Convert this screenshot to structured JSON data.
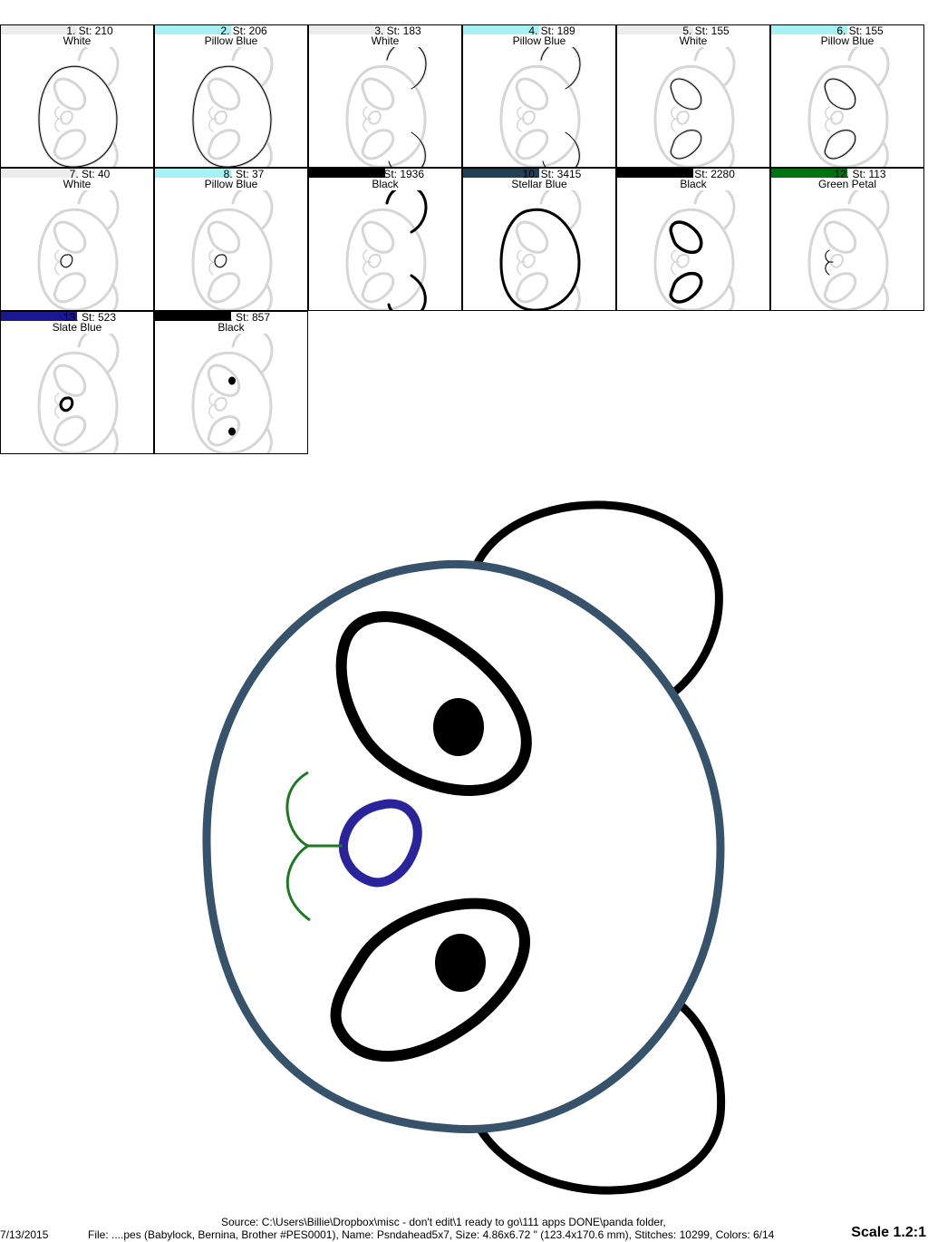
{
  "color_stops": [
    {
      "label": "1. St: 210",
      "color_name": "White",
      "bar_color": "#ececec",
      "part": "face-tack",
      "outline": "#000000"
    },
    {
      "label": "2. St: 206",
      "color_name": "Pillow Blue",
      "bar_color": "#a6f1f4",
      "part": "face-tack",
      "outline": "#000000"
    },
    {
      "label": "3. St: 183",
      "color_name": "White",
      "bar_color": "#ececec",
      "part": "ears-tack",
      "outline": "#000000"
    },
    {
      "label": "4. St: 189",
      "color_name": "Pillow Blue",
      "bar_color": "#a6f1f4",
      "part": "ears-tack",
      "outline": "#000000"
    },
    {
      "label": "5. St: 155",
      "color_name": "White",
      "bar_color": "#ececec",
      "part": "eyes-tack",
      "outline": "#000000"
    },
    {
      "label": "6. St: 155",
      "color_name": "Pillow Blue",
      "bar_color": "#a6f1f4",
      "part": "eyes-tack",
      "outline": "#000000"
    },
    {
      "label": "7. St: 40",
      "color_name": "White",
      "bar_color": "#ececec",
      "part": "nose-tack",
      "outline": "#000000"
    },
    {
      "label": "8. St: 37",
      "color_name": "Pillow Blue",
      "bar_color": "#a6f1f4",
      "part": "nose-tack",
      "outline": "#000000"
    },
    {
      "label": "9. St: 1936",
      "color_name": "Black",
      "bar_color": "#000000",
      "part": "ears-satin",
      "outline": "#000000"
    },
    {
      "label": "10. St: 3415",
      "color_name": "Stellar Blue",
      "bar_color": "#233f56",
      "part": "face-satin",
      "outline": "#000000"
    },
    {
      "label": "11. St: 2280",
      "color_name": "Black",
      "bar_color": "#000000",
      "part": "eyes-satin",
      "outline": "#000000"
    },
    {
      "label": "12. St: 113",
      "color_name": "Green Petal",
      "bar_color": "#00720f",
      "part": "mouth",
      "outline": "#000000"
    },
    {
      "label": "13. St: 523",
      "color_name": "Slate Blue",
      "bar_color": "#1b178f",
      "part": "nose-satin",
      "outline": "#000000"
    },
    {
      "label": "14. St: 857",
      "color_name": "Black",
      "bar_color": "#000000",
      "part": "pupils",
      "outline": "#000000"
    }
  ],
  "preview": {
    "ear_color": "#000000",
    "face_color": "#36536b",
    "eye_color": "#000000",
    "pupil_color": "#000000",
    "nose_color": "#2a249c",
    "mouth_color": "#1d7a22",
    "ghost_color": "#d6d6d6"
  },
  "footer": {
    "date": "7/13/2015",
    "source": "Source: C:\\Users\\Billie\\Dropbox\\misc - don't edit\\1 ready to go\\111 apps DONE\\panda folder,",
    "file_info": "File: ....pes (Babylock, Bernina, Brother #PES0001), Name: Psndahead5x7, Size: 4.86x6.72 \" (123.4x170.6 mm), Stitches: 10299, Colors: 6/14",
    "scale": "Scale 1.2:1"
  }
}
